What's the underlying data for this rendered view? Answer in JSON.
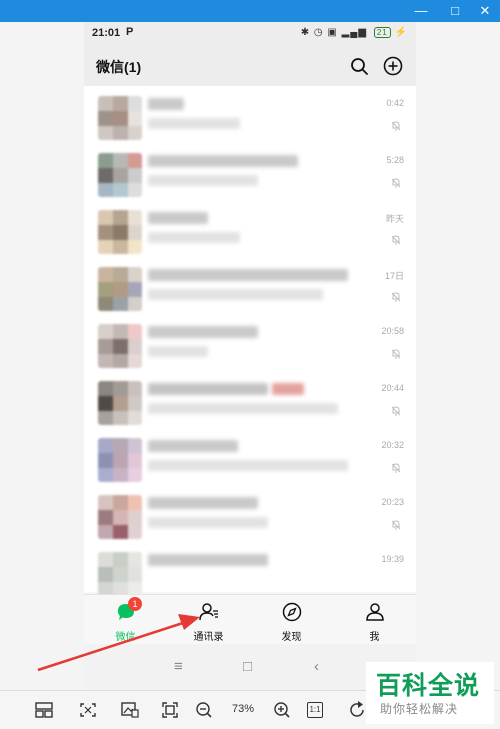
{
  "status": {
    "time": "21:01",
    "carrier_icon": "P",
    "battery": "21"
  },
  "appbar": {
    "title": "微信(1)"
  },
  "chats": [
    {
      "time": "0:42"
    },
    {
      "time": "5:28"
    },
    {
      "time": "昨天"
    },
    {
      "time": "17日"
    },
    {
      "time": "20:58"
    },
    {
      "time": "20:44"
    },
    {
      "time": "20:32"
    },
    {
      "time": "20:23"
    },
    {
      "time": "19:39"
    }
  ],
  "tabbar": {
    "tabs": [
      {
        "label": "微信",
        "badge": "1"
      },
      {
        "label": "通讯录"
      },
      {
        "label": "发现"
      },
      {
        "label": "我"
      }
    ]
  },
  "viewer": {
    "zoom": "73%",
    "one_to_one": "1:1"
  },
  "watermark": {
    "title": "百科全说",
    "subtitle": "助你轻松解决"
  },
  "colors": {
    "accent": "#07c160",
    "titlebar": "#1f8bde",
    "badge": "#f44336",
    "arrow": "#e53935"
  }
}
